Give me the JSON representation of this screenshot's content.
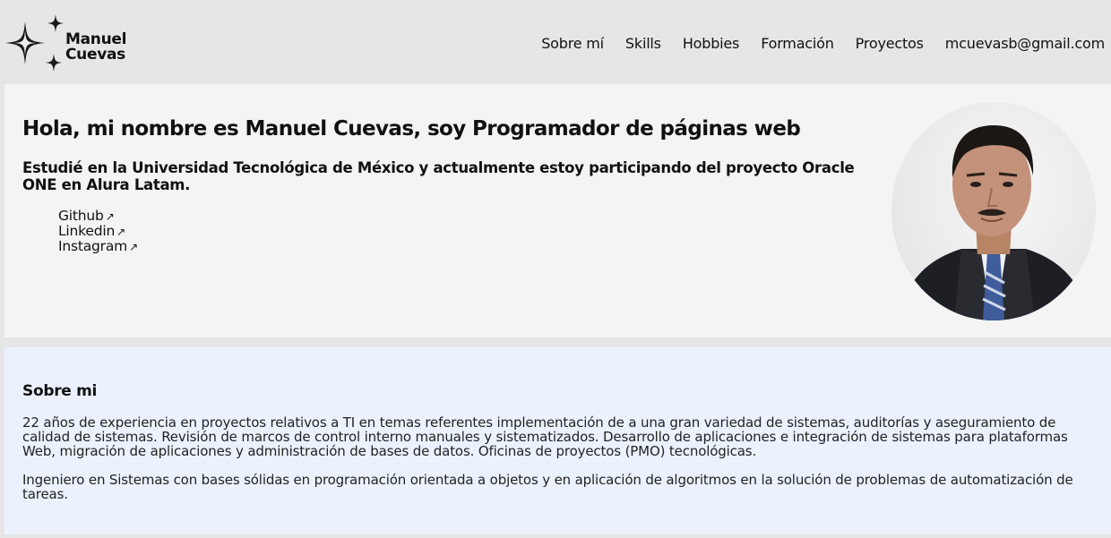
{
  "header": {
    "logo_line1": "Manuel",
    "logo_line2": "Cuevas",
    "nav": [
      "Sobre mí",
      "Skills",
      "Hobbies",
      "Formación",
      "Proyectos",
      "mcuevasb@gmail.com"
    ]
  },
  "hero": {
    "title": "Hola, mi nombre es Manuel Cuevas, soy Programador de páginas web",
    "subtitle": "Estudié en la Universidad Tecnológica de México y actualmente estoy participando del proyecto Oracle ONE en Alura Latam.",
    "links": [
      {
        "label": "Github",
        "icon": "external-link-icon"
      },
      {
        "label": "Linkedin",
        "icon": "external-link-icon"
      },
      {
        "label": "Instagram",
        "icon": "external-link-icon"
      }
    ],
    "arrow_glyph": "↗"
  },
  "about": {
    "title": "Sobre mi",
    "paragraph1": "22 años de experiencia en proyectos relativos a TI en temas referentes implementación de a una gran variedad de sistemas, auditorías y aseguramiento de calidad de sistemas. Revisión de marcos de control interno manuales y sistematizados. Desarrollo de aplicaciones e integración de sistemas para plataformas Web, migración de aplicaciones y administración de bases de datos. Oficinas de proyectos (PMO) tecnológicas.",
    "paragraph2": "Ingeniero en Sistemas con bases sólidas en programación orientada a objetos y en aplicación de algoritmos en la solución de problemas de automatización de tareas."
  }
}
